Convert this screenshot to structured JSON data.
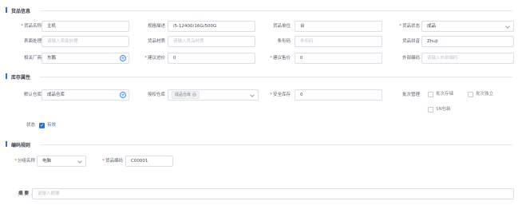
{
  "sections": {
    "goods_info": "货品信息",
    "inventory_attr": "库存属性",
    "coding_rule": "编码规则"
  },
  "goods": {
    "name": {
      "label": "货品名称",
      "value": "主机"
    },
    "spec": {
      "label": "规格描述",
      "value": "i5-12400/16G/500G"
    },
    "unit": {
      "label": "货品单位",
      "value": "台"
    },
    "status": {
      "label": "货品状态",
      "value": "成品"
    },
    "surface": {
      "label": "表面处理",
      "placeholder": "请输入表面处理"
    },
    "material": {
      "label": "货品材质",
      "placeholder": "请输入货品材质"
    },
    "barcode": {
      "label": "条形码",
      "placeholder": "条形码"
    },
    "pinyin": {
      "label": "货品拼音",
      "value": "Zhuji"
    },
    "vendor": {
      "label": "相关厂商",
      "value": "东鹏"
    },
    "buy_price": {
      "label": "建议进价",
      "value": "0"
    },
    "sell_price": {
      "label": "建议售价",
      "value": "0"
    },
    "ext_code": {
      "label": "外部编码",
      "placeholder": "请输入外部编码"
    }
  },
  "inventory": {
    "default_wh": {
      "label": "默认仓库",
      "value": "成品仓库"
    },
    "auth_wh": {
      "label": "授权仓库",
      "tag": "成品仓库"
    },
    "safe_stock": {
      "label": "安全库存",
      "value": "0"
    },
    "batch_mgmt": {
      "label": "批次管理"
    },
    "batch_stock": "批次存储",
    "batch_indep": "批次独立",
    "sn_pack": "SN包装",
    "state": {
      "label": "状态",
      "value": "有效"
    }
  },
  "coding": {
    "category": {
      "label": "分组名称",
      "value": "电脑"
    },
    "code": {
      "label": "货品编码",
      "value": "C00001"
    }
  },
  "summary": {
    "label": "摘 要",
    "placeholder": "请输入摘要"
  },
  "colors": {
    "accent": "#2f6fdc",
    "required": "#e04848",
    "border": "#dcdfe6"
  }
}
